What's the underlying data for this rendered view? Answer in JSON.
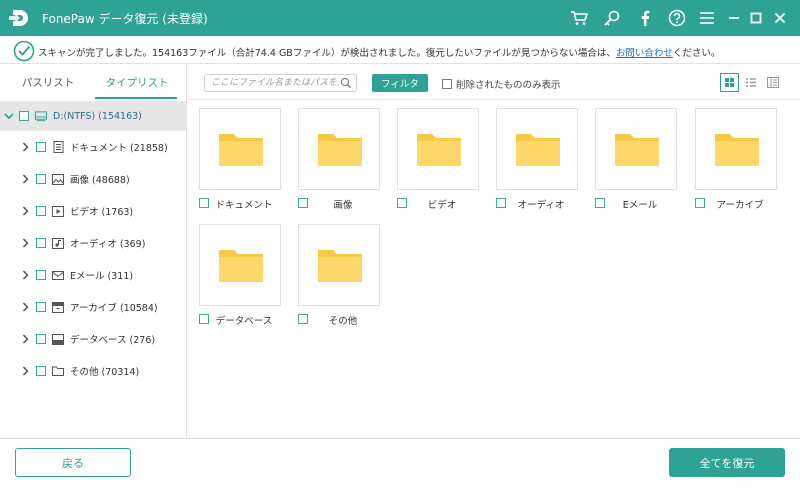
{
  "window": {
    "title": "FonePaw データ復元 (未登録)",
    "icons": [
      "cart-icon",
      "key-icon",
      "facebook-icon",
      "help-icon",
      "menu-icon",
      "minimize-icon",
      "maximize-icon",
      "close-icon"
    ]
  },
  "status": {
    "message": "スキャンが完了しました。154163ファイル（合計74.4 GBファイル）が検出されました。復元したいファイルが見つからない場合は、",
    "link": "お問い合わせ",
    "suffix": "ください。"
  },
  "sidebar": {
    "tabs": [
      {
        "label": "パスリスト",
        "active": false
      },
      {
        "label": "タイプリスト",
        "active": true
      }
    ],
    "drive": {
      "label": "D:(NTFS) (154163)"
    },
    "items": [
      {
        "label": "ドキュメント (21858)",
        "icon": "document-icon"
      },
      {
        "label": "画像 (48688)",
        "icon": "image-icon"
      },
      {
        "label": "ビデオ (1763)",
        "icon": "video-icon"
      },
      {
        "label": "オーディオ (369)",
        "icon": "audio-icon"
      },
      {
        "label": "Eメール (311)",
        "icon": "email-icon"
      },
      {
        "label": "アーカイブ (10584)",
        "icon": "archive-icon"
      },
      {
        "label": "データベース (276)",
        "icon": "database-icon"
      },
      {
        "label": "その他 (70314)",
        "icon": "folder-icon"
      }
    ]
  },
  "toolbar": {
    "search_placeholder": "ここにファイル名またはパスを入力",
    "filter_label": "フィルタ",
    "show_deleted_label": "削除されたもののみ表示",
    "view_modes": [
      "grid-view-icon",
      "list-view-icon",
      "detail-view-icon"
    ],
    "active_view": "grid"
  },
  "folders": [
    {
      "label": "ドキュメント"
    },
    {
      "label": "画像"
    },
    {
      "label": "ビデオ"
    },
    {
      "label": "オーディオ"
    },
    {
      "label": "Eメール"
    },
    {
      "label": "アーカイブ"
    },
    {
      "label": "データベース"
    },
    {
      "label": "その他"
    }
  ],
  "footer": {
    "back_label": "戻る",
    "recover_label": "全てを復元"
  },
  "colors": {
    "accent": "#2ea295",
    "link": "#1d6fd1",
    "folder": "#f9cf5b"
  }
}
